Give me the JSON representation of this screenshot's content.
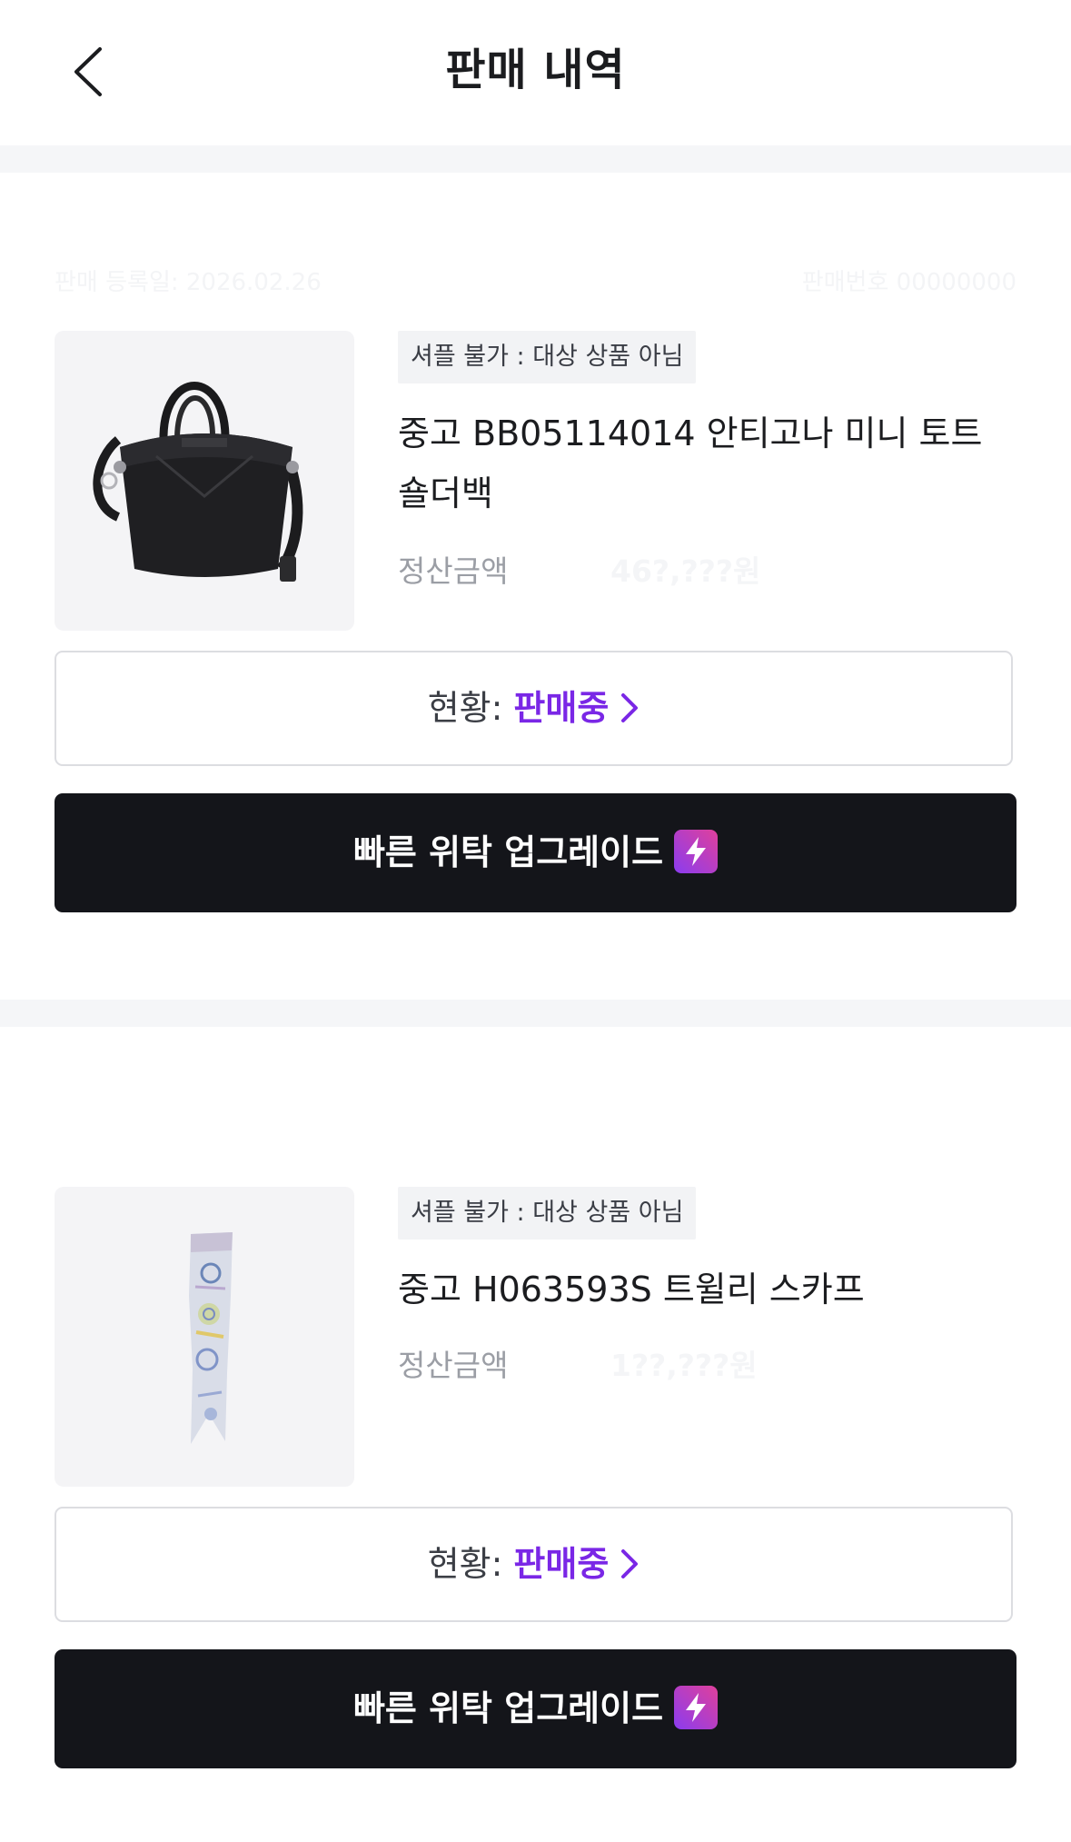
{
  "header": {
    "title": "판매 내역"
  },
  "items": [
    {
      "registered_label": "판매 등록일: 2026.02.26",
      "order_label": "판매번호 00000000",
      "badge": "셔플 불가 : 대상 상품 아님",
      "title": "중고 BB05114014 안티고나 미니 토트 숄더백",
      "amount_label": "정산금액",
      "amount_value": "46?,???원",
      "status_label": "현황:",
      "status_value": "판매중",
      "upgrade_label": "빠른 위탁 업그레이드",
      "image_icon": "handbag-image"
    },
    {
      "registered_label": "",
      "order_label": "",
      "badge": "셔플 불가 : 대상 상품 아님",
      "title": "중고 H063593S 트윌리 스카프",
      "amount_label": "정산금액",
      "amount_value": "1??,???원",
      "status_label": "현황:",
      "status_value": "판매중",
      "upgrade_label": "빠른 위탁 업그레이드",
      "image_icon": "scarf-image"
    }
  ],
  "colors": {
    "accent": "#7a27e6",
    "button_dark": "#14151a",
    "divider": "#f5f6f8"
  }
}
